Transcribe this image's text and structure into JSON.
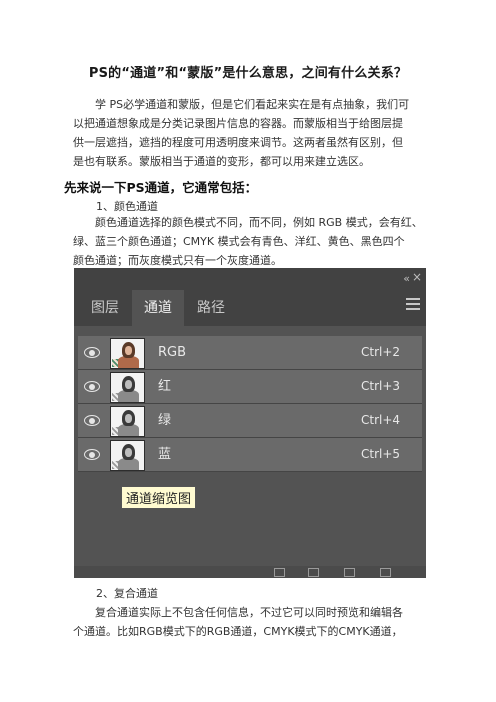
{
  "article": {
    "title": "PS的“通道”和“蒙版”是什么意思，之间有什么关系？",
    "intro_lines": [
      "学 PS必学通道和蒙版，但是它们看起来实在是有点抽象，我们可",
      "以把通道想象成是分类记录图片信息的容器。而蒙版相当于给图层提",
      "供一层遮挡，遮挡的程度可用透明度来调节。这两者虽然有区别，但",
      "是也有联系。蒙版相当于通道的变形，都可以用来建立选区。"
    ],
    "heading": "先来说一下PS通道，它通常包括：",
    "section1_title": "1、颜色通道",
    "section1_lines": [
      "颜色通道选择的颜色模式不同，而不同，例如 RGB 模式，会有红、",
      "绿、蓝三个颜色通道；CMYK 模式会有青色、洋红、黄色、黑色四个",
      "颜色通道；而灰度模式只有一个灰度通道。"
    ],
    "section2_title": "2、复合通道",
    "section2_lines": [
      "复合通道实际上不包含任何信息，不过它可以同时预览和编辑各",
      "个通道。比如RGB模式下的RGB通道，CMYK模式下的CMYK通道，"
    ]
  },
  "panel": {
    "collapse_icon": "«",
    "close_icon": "×",
    "tabs": [
      "图层",
      "通道",
      "路径"
    ],
    "active_tab": "通道",
    "channels": [
      {
        "name": "RGB",
        "shortcut": "Ctrl+2"
      },
      {
        "name": "红",
        "shortcut": "Ctrl+3"
      },
      {
        "name": "绿",
        "shortcut": "Ctrl+4"
      },
      {
        "name": "蓝",
        "shortcut": "Ctrl+5"
      }
    ],
    "callout": "通道缩览图",
    "colors": {
      "panel_bg": "#535353",
      "tab_bar": "#424242",
      "row_bg": "#6a6a6a",
      "callout_bg": "#fffbd1"
    }
  }
}
